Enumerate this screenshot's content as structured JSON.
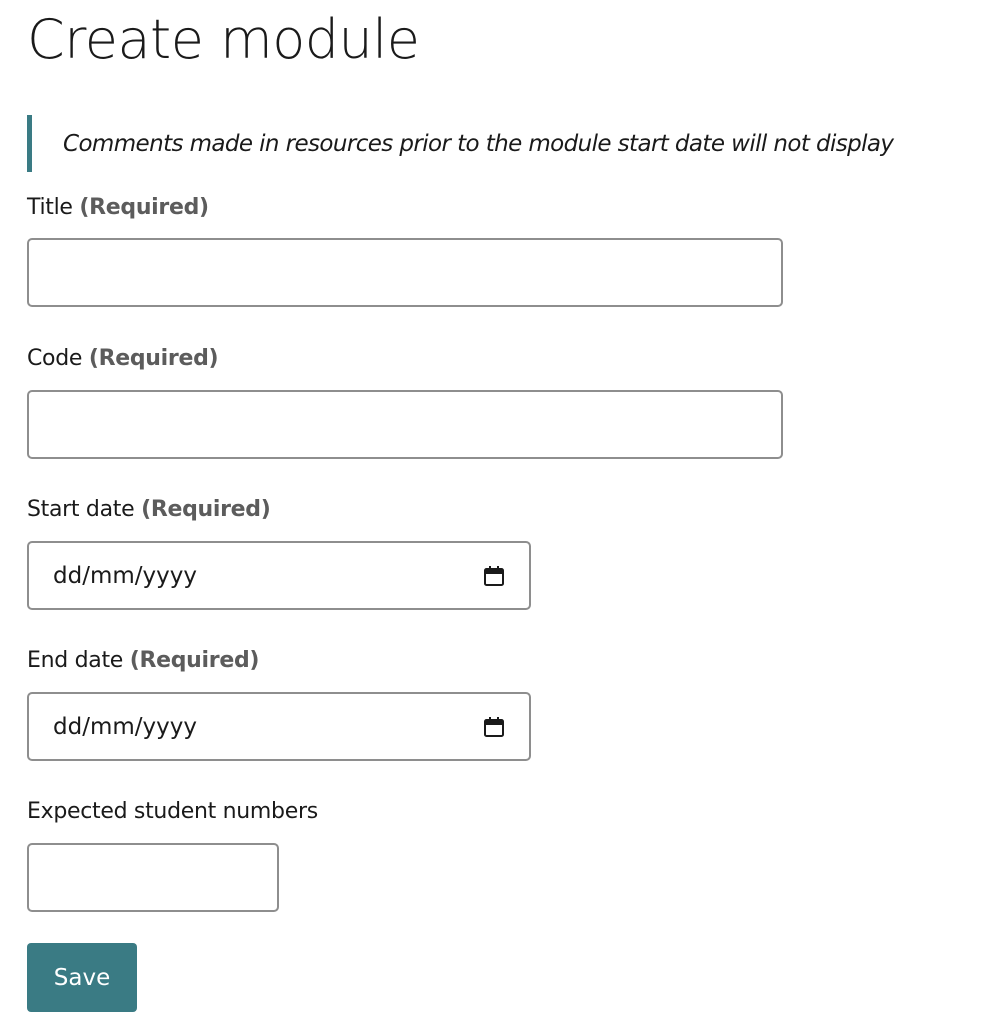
{
  "page": {
    "title": "Create module"
  },
  "notice": {
    "text": "Comments made in resources prior to the module start date will not display"
  },
  "form": {
    "title": {
      "label": "Title",
      "required_marker": "(Required)",
      "value": ""
    },
    "code": {
      "label": "Code",
      "required_marker": "(Required)",
      "value": ""
    },
    "start_date": {
      "label": "Start date",
      "required_marker": "(Required)",
      "placeholder": "dd/mm/yyyy",
      "icon": "calendar-icon"
    },
    "end_date": {
      "label": "End date",
      "required_marker": "(Required)",
      "placeholder": "dd/mm/yyyy",
      "icon": "calendar-icon"
    },
    "student_numbers": {
      "label": "Expected student numbers",
      "value": ""
    }
  },
  "actions": {
    "save_label": "Save"
  },
  "colors": {
    "accent": "#3a7b84",
    "required_text": "#5c5c5c",
    "input_border": "#8e8e8e"
  }
}
